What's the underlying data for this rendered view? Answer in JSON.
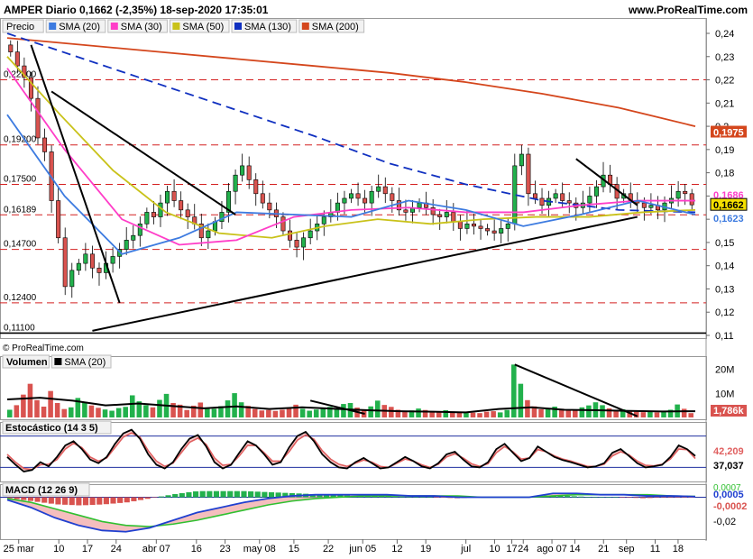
{
  "header": {
    "title": "AMPER Diario 0,1662 (-2,35%) 18-sep-2020 17:35:01",
    "site": "www.ProRealTime.com",
    "copyright": "© ProRealTime.com"
  },
  "colors": {
    "bull": "#22b14c",
    "bear": "#d9534f",
    "sma20": "#3d7be0",
    "sma30": "#ff3ec8",
    "sma50": "#c9c21a",
    "sma130": "#1030c0",
    "sma200": "#d4461c",
    "hline": "#d42020",
    "stoch_k": "#000000",
    "stoch_d": "#e06060",
    "macd": "#2040d0",
    "signal": "#30c030"
  },
  "chart_data": [
    {
      "type": "candlestick",
      "panel": "price",
      "legend": [
        "Precio",
        "SMA (20)",
        "SMA (30)",
        "SMA (50)",
        "SMA (130)",
        "SMA (200)"
      ],
      "y_ticks": [
        "0,24",
        "0,23",
        "0,22",
        "0,21",
        "0,2",
        "0,19",
        "0,18",
        "0,17",
        "0,16",
        "0,15",
        "0,14",
        "0,13",
        "0,12",
        "0,11"
      ],
      "ylim": [
        0.11,
        0.24
      ],
      "x_ticks": [
        "25 mar",
        "10",
        "17",
        "24",
        "abr 07",
        "16",
        "23",
        "may 08",
        "15",
        "22",
        "jun 05",
        "12",
        "19",
        "jul",
        "10",
        "17",
        "24",
        "ago 07",
        "14",
        "21",
        "sep",
        "11",
        "18"
      ],
      "levels": [
        "0,22000",
        "0,19200",
        "0,17500",
        "0,16189",
        "0,14700",
        "0,12400",
        "0,11100"
      ],
      "level_values": [
        0.22,
        0.192,
        0.175,
        0.16189,
        0.147,
        0.124,
        0.111
      ],
      "right_labels": {
        "sma200": "0,1975",
        "sma30": "0,1685",
        "last": "0,1662",
        "sma20": "0,1623",
        "other": "0,1686"
      },
      "sma200_values": [
        0.238,
        0.235,
        0.232,
        0.229,
        0.226,
        0.223,
        0.219,
        0.214,
        0.208,
        0.2
      ],
      "sma130_values": [
        0.24,
        0.229,
        0.218,
        0.207,
        0.196,
        0.184,
        0.175,
        0.168,
        0.164,
        0.163
      ],
      "sma50_values": [
        0.23,
        0.205,
        0.181,
        0.163,
        0.154,
        0.152,
        0.157,
        0.16,
        0.158,
        0.16,
        0.161,
        0.161,
        0.163,
        0.164
      ],
      "sma30_values": [
        0.225,
        0.19,
        0.16,
        0.149,
        0.151,
        0.161,
        0.164,
        0.165,
        0.163,
        0.163,
        0.166,
        0.168,
        0.168
      ],
      "sma20_values": [
        0.205,
        0.17,
        0.145,
        0.152,
        0.163,
        0.162,
        0.161,
        0.168,
        0.164,
        0.157,
        0.162,
        0.168,
        0.162
      ],
      "closes": [
        0.232,
        0.226,
        0.221,
        0.212,
        0.195,
        0.189,
        0.168,
        0.152,
        0.131,
        0.138,
        0.141,
        0.145,
        0.139,
        0.137,
        0.141,
        0.144,
        0.147,
        0.151,
        0.153,
        0.158,
        0.163,
        0.161,
        0.167,
        0.172,
        0.168,
        0.164,
        0.161,
        0.158,
        0.152,
        0.155,
        0.159,
        0.163,
        0.172,
        0.179,
        0.183,
        0.177,
        0.171,
        0.167,
        0.164,
        0.161,
        0.155,
        0.151,
        0.148,
        0.152,
        0.155,
        0.158,
        0.161,
        0.163,
        0.167,
        0.169,
        0.171,
        0.169,
        0.167,
        0.172,
        0.174,
        0.171,
        0.168,
        0.164,
        0.163,
        0.165,
        0.167,
        0.165,
        0.162,
        0.161,
        0.163,
        0.159,
        0.156,
        0.158,
        0.157,
        0.156,
        0.155,
        0.154,
        0.156,
        0.158,
        0.183,
        0.188,
        0.171,
        0.169,
        0.166,
        0.169,
        0.171,
        0.168,
        0.167,
        0.165,
        0.167,
        0.17,
        0.174,
        0.179,
        0.175,
        0.169,
        0.171,
        0.168,
        0.167,
        0.165,
        0.166,
        0.164,
        0.167,
        0.169,
        0.172,
        0.171,
        0.1662
      ]
    },
    {
      "type": "bar",
      "panel": "volume",
      "legend": [
        "Volumen",
        "SMA (20)"
      ],
      "y_ticks": [
        "20M",
        "10M"
      ],
      "last_label": "1,786k",
      "values": [
        3.2,
        5.1,
        9.5,
        14.0,
        7.2,
        4.5,
        11.0,
        6.0,
        3.5,
        4.2,
        8.1,
        6.5,
        5.0,
        4.0,
        3.3,
        2.8,
        3.9,
        4.4,
        9.2,
        6.7,
        5.1,
        4.2,
        7.3,
        9.8,
        6.0,
        5.3,
        3.1,
        4.9,
        6.2,
        4.0,
        3.6,
        4.7,
        7.1,
        10.1,
        6.3,
        4.8,
        3.5,
        2.9,
        3.1,
        2.7,
        3.2,
        4.1,
        5.3,
        3.6,
        2.8,
        3.3,
        4.0,
        4.4,
        3.9,
        5.6,
        6.0,
        4.1,
        3.4,
        4.6,
        7.0,
        5.2,
        4.4,
        3.2,
        2.6,
        2.9,
        3.7,
        3.1,
        2.4,
        2.2,
        3.0,
        2.5,
        2.1,
        2.3,
        2.0,
        1.8,
        2.4,
        2.6,
        2.1,
        3.1,
        22.0,
        14.0,
        7.2,
        4.6,
        3.4,
        3.8,
        4.5,
        3.6,
        3.0,
        3.3,
        4.2,
        5.0,
        6.3,
        5.1,
        3.8,
        3.1,
        3.4,
        2.6,
        2.4,
        2.2,
        2.5,
        2.1,
        2.7,
        3.2,
        5.4,
        3.6,
        1.8
      ],
      "sma_values": [
        7.5,
        8.2,
        7.0,
        5.0,
        5.8,
        4.8,
        3.8,
        4.6,
        3.5,
        4.2,
        3.6,
        3.0,
        2.6,
        2.4,
        2.1,
        3.5,
        4.2,
        3.2,
        3.0,
        2.7,
        2.5,
        2.6
      ]
    },
    {
      "type": "line",
      "panel": "stochastic",
      "legend": [
        "Estocástico (14 3 5)"
      ],
      "last_labels": [
        "42,209",
        "37,037"
      ],
      "bands": [
        80,
        20
      ],
      "k_values": [
        40,
        25,
        12,
        15,
        30,
        22,
        40,
        62,
        70,
        55,
        35,
        28,
        40,
        65,
        85,
        92,
        75,
        45,
        25,
        18,
        30,
        55,
        75,
        82,
        60,
        30,
        18,
        25,
        48,
        70,
        62,
        45,
        25,
        30,
        58,
        80,
        88,
        70,
        45,
        30,
        20,
        18,
        30,
        38,
        28,
        18,
        20,
        30,
        40,
        32,
        22,
        18,
        28,
        45,
        50,
        35,
        22,
        20,
        30,
        55,
        65,
        48,
        32,
        38,
        60,
        50,
        40,
        34,
        30,
        25,
        20,
        22,
        28,
        48,
        55,
        42,
        28,
        20,
        22,
        25,
        40,
        62,
        55,
        42
      ],
      "d_values": [
        45,
        30,
        18,
        16,
        25,
        26,
        35,
        55,
        66,
        58,
        40,
        32,
        38,
        58,
        78,
        86,
        78,
        52,
        32,
        22,
        28,
        48,
        68,
        76,
        64,
        38,
        24,
        26,
        42,
        62,
        62,
        48,
        32,
        32,
        50,
        72,
        82,
        74,
        52,
        36,
        26,
        22,
        28,
        34,
        30,
        22,
        20,
        28,
        36,
        32,
        25,
        20,
        26,
        40,
        46,
        38,
        27,
        22,
        27,
        48,
        60,
        50,
        36,
        38,
        54,
        50,
        42,
        36,
        32,
        27,
        22,
        22,
        26,
        42,
        50,
        44,
        32,
        24,
        23,
        26,
        36,
        55,
        54,
        37
      ]
    },
    {
      "type": "line",
      "panel": "macd",
      "legend": [
        "MACD (12 26 9)"
      ],
      "last_labels": [
        "0,0007",
        "0,0005",
        "-0,0002"
      ],
      "y_ticks": [
        "-0,02"
      ],
      "macd_values": [
        -0.002,
        -0.008,
        -0.016,
        -0.022,
        -0.026,
        -0.027,
        -0.024,
        -0.018,
        -0.012,
        -0.008,
        -0.004,
        -0.001,
        0.001,
        0.002,
        0.002,
        0.002,
        0.002,
        0.001,
        0.001,
        0.0,
        0.0,
        0.0,
        0.0,
        0.003,
        0.003,
        0.002,
        0.002,
        0.001,
        0.001,
        0.0005
      ],
      "signal_values": [
        -0.001,
        -0.004,
        -0.009,
        -0.014,
        -0.019,
        -0.022,
        -0.023,
        -0.021,
        -0.018,
        -0.014,
        -0.01,
        -0.006,
        -0.003,
        -0.001,
        0.0,
        0.001,
        0.001,
        0.001,
        0.001,
        0.001,
        0.0,
        0.0,
        0.0,
        0.001,
        0.002,
        0.002,
        0.002,
        0.002,
        0.001,
        0.0007
      ]
    }
  ]
}
